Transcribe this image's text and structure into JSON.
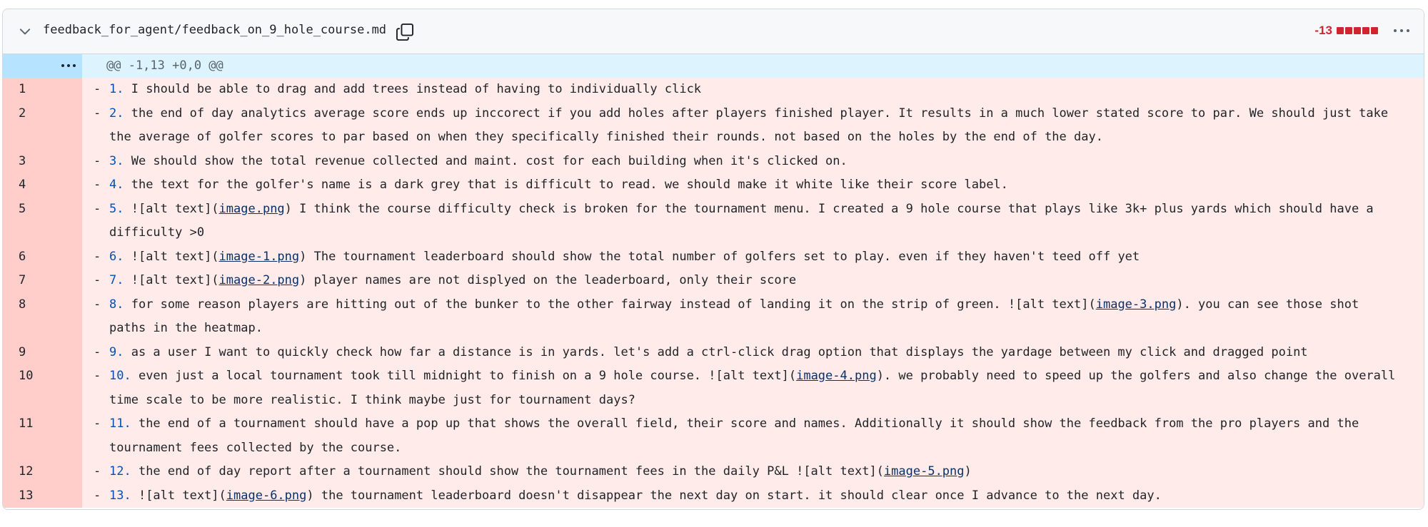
{
  "file": {
    "path": "feedback_for_agent/feedback_on_9_hole_course.md",
    "deletions": "-13",
    "icons": {
      "collapse": "chevron-down-icon",
      "copy": "copy-icon",
      "more": "kebab-horizontal-icon",
      "expand": "unfold-icon"
    }
  },
  "hunk": {
    "header": "@@ -1,13 +0,0 @@"
  },
  "diff_marker": "-",
  "colors": {
    "deleted_bg": "#ffebe9",
    "deleted_gutter": "#ffcecb",
    "deletion_red": "#d1242f",
    "hunk_bg": "#ddf4ff"
  },
  "lines": [
    {
      "ln": "1",
      "parts": [
        {
          "t": "1.",
          "k": "num"
        },
        {
          "t": " I should be able to drag and add trees instead of having to individually click"
        }
      ]
    },
    {
      "ln": "2",
      "parts": [
        {
          "t": "2.",
          "k": "num"
        },
        {
          "t": " the end of day analytics average score ends up inccorect if you add holes after players finished player. It results in a much lower stated score to par. We should just take the average of golfer scores to par based on when they specifically finished their rounds. not based on the holes by the end of the day."
        }
      ]
    },
    {
      "ln": "3",
      "parts": [
        {
          "t": "3.",
          "k": "num"
        },
        {
          "t": " We should show the total revenue collected and maint. cost for each building when it's clicked on."
        }
      ]
    },
    {
      "ln": "4",
      "parts": [
        {
          "t": "4.",
          "k": "num"
        },
        {
          "t": " the text for the golfer's name is a dark grey that is difficult to read. we should make it white like their score label."
        }
      ]
    },
    {
      "ln": "5",
      "parts": [
        {
          "t": "5.",
          "k": "num"
        },
        {
          "t": " ![alt text]("
        },
        {
          "t": "image.png",
          "k": "lnk"
        },
        {
          "t": ") I think the course difficulty check is broken for the tournament menu. I created a 9 hole course that plays like 3k+ plus yards which should have a difficulty >0"
        }
      ]
    },
    {
      "ln": "6",
      "parts": [
        {
          "t": "6.",
          "k": "num"
        },
        {
          "t": " ![alt text]("
        },
        {
          "t": "image-1.png",
          "k": "lnk"
        },
        {
          "t": ") The tournament leaderboard should show the total number of golfers set to play. even if they haven't teed off yet"
        }
      ]
    },
    {
      "ln": "7",
      "parts": [
        {
          "t": "7.",
          "k": "num"
        },
        {
          "t": " ![alt text]("
        },
        {
          "t": "image-2.png",
          "k": "lnk"
        },
        {
          "t": ") player names are not displyed on the leaderboard, only their score"
        }
      ]
    },
    {
      "ln": "8",
      "parts": [
        {
          "t": "8.",
          "k": "num"
        },
        {
          "t": " for some reason players are hitting out of the bunker to the other fairway instead of landing it on the strip of green. ![alt text]("
        },
        {
          "t": "image-3.png",
          "k": "lnk"
        },
        {
          "t": "). you can see those shot paths in the heatmap."
        }
      ]
    },
    {
      "ln": "9",
      "parts": [
        {
          "t": "9.",
          "k": "num"
        },
        {
          "t": " as a user I want to quickly check how far a distance is in yards. let's add a ctrl-click drag option that displays the yardage between my click and dragged point"
        }
      ]
    },
    {
      "ln": "10",
      "parts": [
        {
          "t": "10.",
          "k": "num"
        },
        {
          "t": " even just a local tournament took till midnight to finish on a 9 hole course. ![alt text]("
        },
        {
          "t": "image-4.png",
          "k": "lnk"
        },
        {
          "t": "). we probably need to speed up the golfers and also change the overall time scale to be more realistic. I think maybe just for tournament days?"
        }
      ]
    },
    {
      "ln": "11",
      "parts": [
        {
          "t": "11.",
          "k": "num"
        },
        {
          "t": " the end of a tournament should have a pop up that shows the overall field, their score and names. Additionally it should show the feedback from the pro players and the tournament fees collected by the course."
        }
      ]
    },
    {
      "ln": "12",
      "parts": [
        {
          "t": "12.",
          "k": "num"
        },
        {
          "t": " the end of day report after a tournament should show the tournament fees in the daily P&L ![alt text]("
        },
        {
          "t": "image-5.png",
          "k": "lnk"
        },
        {
          "t": ")"
        }
      ]
    },
    {
      "ln": "13",
      "parts": [
        {
          "t": "13.",
          "k": "num"
        },
        {
          "t": " ![alt text]("
        },
        {
          "t": "image-6.png",
          "k": "lnk"
        },
        {
          "t": ") the tournament leaderboard doesn't disappear the next day on start. it should clear once I advance to the next day."
        }
      ]
    }
  ]
}
